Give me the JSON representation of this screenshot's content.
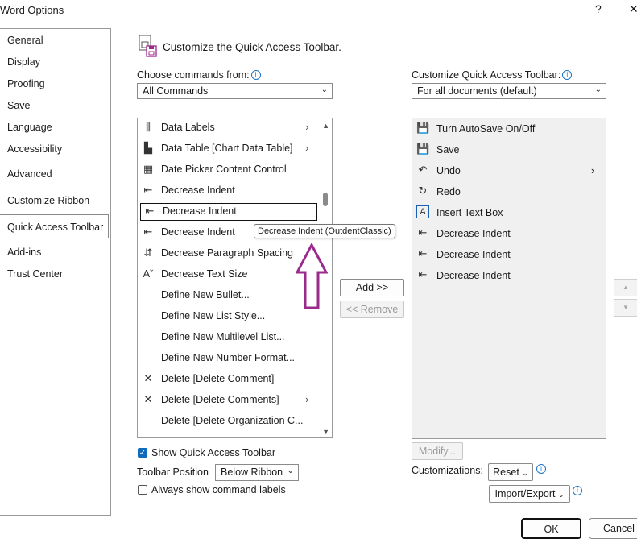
{
  "window": {
    "title": "Word Options",
    "help_glyph": "?",
    "close_glyph": "✕"
  },
  "nav": {
    "items": [
      {
        "label": "General"
      },
      {
        "label": "Display"
      },
      {
        "label": "Proofing"
      },
      {
        "label": "Save"
      },
      {
        "label": "Language"
      },
      {
        "label": "Accessibility"
      },
      {
        "label": "Advanced"
      },
      {
        "label": "Customize Ribbon"
      },
      {
        "label": "Quick Access Toolbar",
        "selected": true
      },
      {
        "label": "Add-ins"
      },
      {
        "label": "Trust Center"
      }
    ]
  },
  "header": {
    "title": "Customize the Quick Access Toolbar.",
    "icon": "quick-access-toolbar-icon"
  },
  "choose": {
    "label": "Choose commands from:",
    "value": "All Commands"
  },
  "customize": {
    "label": "Customize Quick Access Toolbar:",
    "value": "For all documents (default)"
  },
  "commands": {
    "items": [
      {
        "label": "Data Labels",
        "icon": "data-labels-icon",
        "glyph": "⫼",
        "submenu": true
      },
      {
        "label": "Data Table [Chart Data Table]",
        "icon": "data-table-icon",
        "glyph": "▙",
        "submenu": true
      },
      {
        "label": "Date Picker Content Control",
        "icon": "calendar-icon",
        "glyph": "▦"
      },
      {
        "label": "Decrease Indent",
        "icon": "decrease-indent-icon",
        "glyph": "⇤"
      },
      {
        "label": "Decrease Indent",
        "icon": "decrease-indent-icon",
        "glyph": "⇤",
        "focused": true
      },
      {
        "label": "Decrease Indent",
        "icon": "decrease-indent-icon",
        "glyph": "⇤"
      },
      {
        "label": "Decrease Paragraph Spacing",
        "icon": "paragraph-spacing-icon",
        "glyph": "⇵"
      },
      {
        "label": "Decrease Text Size",
        "icon": "decrease-text-size-icon",
        "glyph": "Aˇ"
      },
      {
        "label": "Define New Bullet...",
        "icon": "",
        "glyph": ""
      },
      {
        "label": "Define New List Style...",
        "icon": "",
        "glyph": ""
      },
      {
        "label": "Define New Multilevel List...",
        "icon": "",
        "glyph": ""
      },
      {
        "label": "Define New Number Format...",
        "icon": "",
        "glyph": ""
      },
      {
        "label": "Delete [Delete Comment]",
        "icon": "delete-comment-icon",
        "glyph": "✕"
      },
      {
        "label": "Delete [Delete Comments]",
        "icon": "delete-comments-icon",
        "glyph": "✕",
        "submenu": true
      },
      {
        "label": "Delete [Delete Organization C...",
        "icon": "",
        "glyph": ""
      }
    ],
    "submenu_glyph": "›",
    "scroll_up_glyph": "▲",
    "scroll_down_glyph": "▼"
  },
  "toolbar_items": {
    "items": [
      {
        "label": "Turn AutoSave On/Off",
        "icon": "autosave-icon",
        "glyph": "💾"
      },
      {
        "label": "Save",
        "icon": "save-icon",
        "glyph": "💾"
      },
      {
        "label": "Undo",
        "icon": "undo-icon",
        "glyph": "↶",
        "submenu": true
      },
      {
        "label": "Redo",
        "icon": "redo-icon",
        "glyph": "↻"
      },
      {
        "label": "Insert Text Box",
        "icon": "text-box-icon",
        "glyph": "A"
      },
      {
        "label": "Decrease Indent",
        "icon": "decrease-indent-icon",
        "glyph": "⇤"
      },
      {
        "label": "Decrease Indent",
        "icon": "decrease-indent-icon",
        "glyph": "⇤"
      },
      {
        "label": "Decrease Indent",
        "icon": "decrease-indent-icon",
        "glyph": "⇤"
      }
    ]
  },
  "tooltip": {
    "text": "Decrease Indent (OutdentClassic)"
  },
  "buttons": {
    "add": "Add >>",
    "remove": "<< Remove",
    "modify": "Modify...",
    "reset": "Reset",
    "import_export": "Import/Export",
    "ok": "OK",
    "cancel": "Cancel",
    "move_up_glyph": "▲",
    "move_down_glyph": "▼"
  },
  "options": {
    "show_qat": {
      "label": "Show Quick Access Toolbar",
      "checked": true
    },
    "position_label": "Toolbar Position",
    "position_value": "Below Ribbon",
    "always_labels": {
      "label": "Always show command labels",
      "checked": false
    }
  },
  "customizations_label": "Customizations:",
  "colors": {
    "accent": "#0f6cbd",
    "arrow": "#9b2a8d",
    "save_icon": "#9b2a8d",
    "hint": "#1a73c8"
  }
}
